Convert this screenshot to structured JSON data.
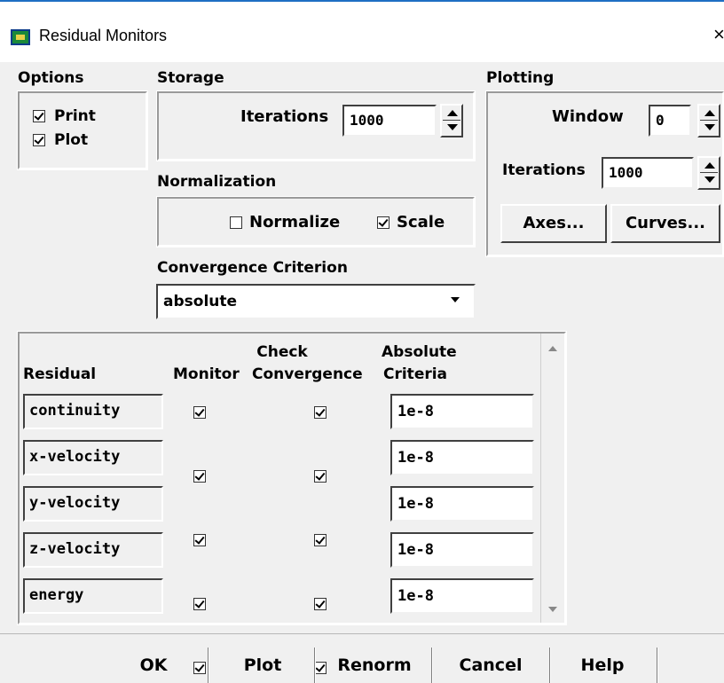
{
  "window": {
    "title": "Residual Monitors",
    "close_glyph": "×"
  },
  "options": {
    "label": "Options",
    "print": {
      "label": "Print",
      "checked": true
    },
    "plot": {
      "label": "Plot",
      "checked": true
    }
  },
  "storage": {
    "label": "Storage",
    "iterations_label": "Iterations",
    "iterations_value": "1000"
  },
  "normalization": {
    "label": "Normalization",
    "normalize": {
      "label": "Normalize",
      "checked": false
    },
    "scale": {
      "label": "Scale",
      "checked": true
    }
  },
  "convergence": {
    "label": "Convergence Criterion",
    "selected": "absolute"
  },
  "plotting": {
    "label": "Plotting",
    "window_label": "Window",
    "window_value": "0",
    "iterations_label": "Iterations",
    "iterations_value": "1000",
    "axes_button": "Axes...",
    "curves_button": "Curves..."
  },
  "table": {
    "headers": {
      "residual": "Residual",
      "monitor": "Monitor",
      "check_line1": "Check",
      "check_line2": "Convergence",
      "abs_line1": "Absolute",
      "abs_line2": "Criteria"
    },
    "rows": [
      {
        "name": "continuity",
        "monitor": true,
        "check": true,
        "criteria": "1e-8"
      },
      {
        "name": "x-velocity",
        "monitor": true,
        "check": true,
        "criteria": "1e-8"
      },
      {
        "name": "y-velocity",
        "monitor": true,
        "check": true,
        "criteria": "1e-8"
      },
      {
        "name": "z-velocity",
        "monitor": true,
        "check": true,
        "criteria": "1e-8"
      },
      {
        "name": "energy",
        "monitor": true,
        "check": true,
        "criteria": "1e-8"
      }
    ]
  },
  "buttons": {
    "ok": "OK",
    "plot": "Plot",
    "renorm": "Renorm",
    "cancel": "Cancel",
    "help": "Help"
  },
  "colors": {
    "title_accent": "#1e6fc4",
    "dialog_bg": "#f0f0f0"
  }
}
